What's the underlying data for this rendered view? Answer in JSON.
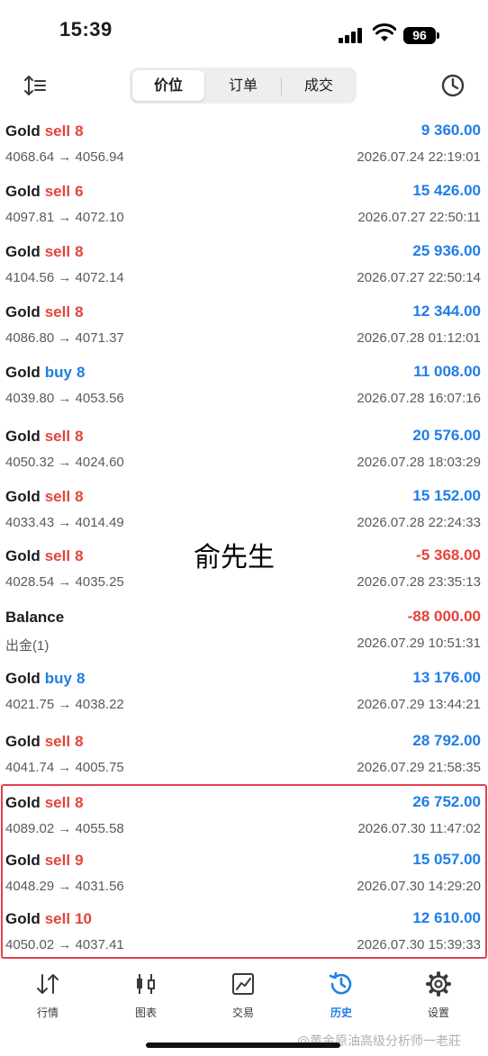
{
  "status": {
    "time": "15:39",
    "battery": "96"
  },
  "tabs": [
    "价位",
    "订单",
    "成交"
  ],
  "rows": [
    {
      "symbol": "Gold",
      "side": "sell",
      "volume": "8",
      "prices": "4068.64 → 4056.94",
      "profit": "9 360.00",
      "time": "2026.07.24 22:19:01"
    },
    {
      "symbol": "Gold",
      "side": "sell",
      "volume": "6",
      "prices": "4097.81 → 4072.10",
      "profit": "15 426.00",
      "time": "2026.07.27 22:50:11"
    },
    {
      "symbol": "Gold",
      "side": "sell",
      "volume": "8",
      "prices": "4104.56 → 4072.14",
      "profit": "25 936.00",
      "time": "2026.07.27 22:50:14"
    },
    {
      "symbol": "Gold",
      "side": "sell",
      "volume": "8",
      "prices": "4086.80 → 4071.37",
      "profit": "12 344.00",
      "time": "2026.07.28 01:12:01"
    },
    {
      "symbol": "Gold",
      "side": "buy",
      "volume": "8",
      "prices": "4039.80 → 4053.56",
      "profit": "11 008.00",
      "time": "2026.07.28 16:07:16"
    },
    {
      "symbol": "Gold",
      "side": "sell",
      "volume": "8",
      "prices": "4050.32 → 4024.60",
      "profit": "20 576.00",
      "time": "2026.07.28 18:03:29"
    },
    {
      "symbol": "Gold",
      "side": "sell",
      "volume": "8",
      "prices": "4033.43 → 4014.49",
      "profit": "15 152.00",
      "time": "2026.07.28 22:24:33"
    },
    {
      "symbol": "Gold",
      "side": "sell",
      "volume": "8",
      "prices": "4028.54 → 4035.25",
      "profit": "-5 368.00",
      "time": "2026.07.28 23:35:13"
    },
    {
      "symbol": "Balance",
      "side": "",
      "volume": "",
      "prices": "出金(1)",
      "profit": "-88 000.00",
      "time": "2026.07.29 10:51:31"
    },
    {
      "symbol": "Gold",
      "side": "buy",
      "volume": "8",
      "prices": "4021.75 → 4038.22",
      "profit": "13 176.00",
      "time": "2026.07.29 13:44:21"
    },
    {
      "symbol": "Gold",
      "side": "sell",
      "volume": "8",
      "prices": "4041.74 → 4005.75",
      "profit": "28 792.00",
      "time": "2026.07.29 21:58:35"
    },
    {
      "symbol": "Gold",
      "side": "sell",
      "volume": "8",
      "prices": "4089.02 → 4055.58",
      "profit": "26 752.00",
      "time": "2026.07.30 11:47:02"
    },
    {
      "symbol": "Gold",
      "side": "sell",
      "volume": "9",
      "prices": "4048.29 → 4031.56",
      "profit": "15 057.00",
      "time": "2026.07.30 14:29:20"
    },
    {
      "symbol": "Gold",
      "side": "sell",
      "volume": "10",
      "prices": "4050.02 → 4037.41",
      "profit": "12 610.00",
      "time": "2026.07.30 15:39:33"
    }
  ],
  "overlay_text": "俞先生",
  "bottom_tabs": [
    {
      "label": "行情",
      "icon": "quotes-icon"
    },
    {
      "label": "图表",
      "icon": "chart-icon"
    },
    {
      "label": "交易",
      "icon": "trade-icon"
    },
    {
      "label": "历史",
      "icon": "history-icon"
    },
    {
      "label": "设置",
      "icon": "settings-icon"
    }
  ],
  "watermark": "@黄金原油高级分析师一老莊",
  "colors": {
    "sell": "#e5433c",
    "buy": "#1f7ee6",
    "profit_positive": "#1f7ee6",
    "profit_negative": "#e5433c",
    "highlight_border": "#e4424c",
    "active_tab": "#1f7ee6"
  }
}
